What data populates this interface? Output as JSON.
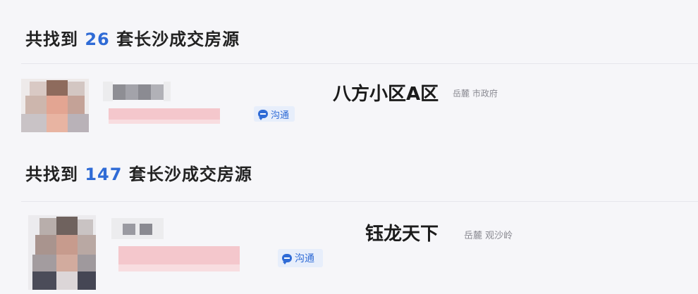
{
  "results": [
    {
      "prefix": "共找到",
      "count": "26",
      "suffix": "套长沙成交房源",
      "agent": {
        "chat_label": "沟通"
      },
      "estate": {
        "name": "八方小区A区",
        "district": "岳麓",
        "sub_area": "市政府"
      }
    },
    {
      "prefix": "共找到",
      "count": "147",
      "suffix": "套长沙成交房源",
      "agent": {
        "chat_label": "沟通"
      },
      "estate": {
        "name": "钰龙天下",
        "district": "岳麓",
        "sub_area": "观沙岭"
      }
    }
  ],
  "colors": {
    "accent": "#2f6bd6",
    "background": "#f6f6f9",
    "chat_button_bg": "#e7eefb",
    "name_blur": "#f4c7cc"
  }
}
